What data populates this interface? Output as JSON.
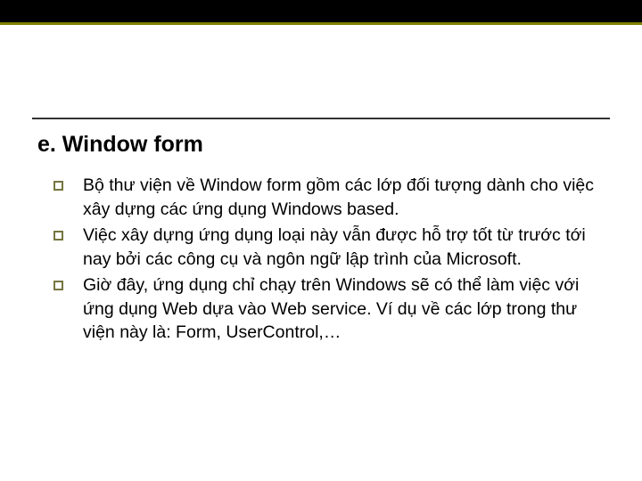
{
  "heading": "e. Window form",
  "bullets": [
    "Bộ thư viện về Window form gồm các lớp đối tượng dành cho việc xây dựng các ứng dụng Windows based.",
    "Việc xây dựng ứng dụng loại này vẫn được hỗ trợ tốt từ trước tới nay bởi các công cụ và ngôn ngữ lập trình của Microsoft.",
    "Giờ đây, ứng dụng chỉ chạy trên Windows sẽ có thể làm việc với ứng dụng Web dựa vào Web service. Ví dụ về các lớp trong thư viện này là: Form, UserControl,…"
  ]
}
